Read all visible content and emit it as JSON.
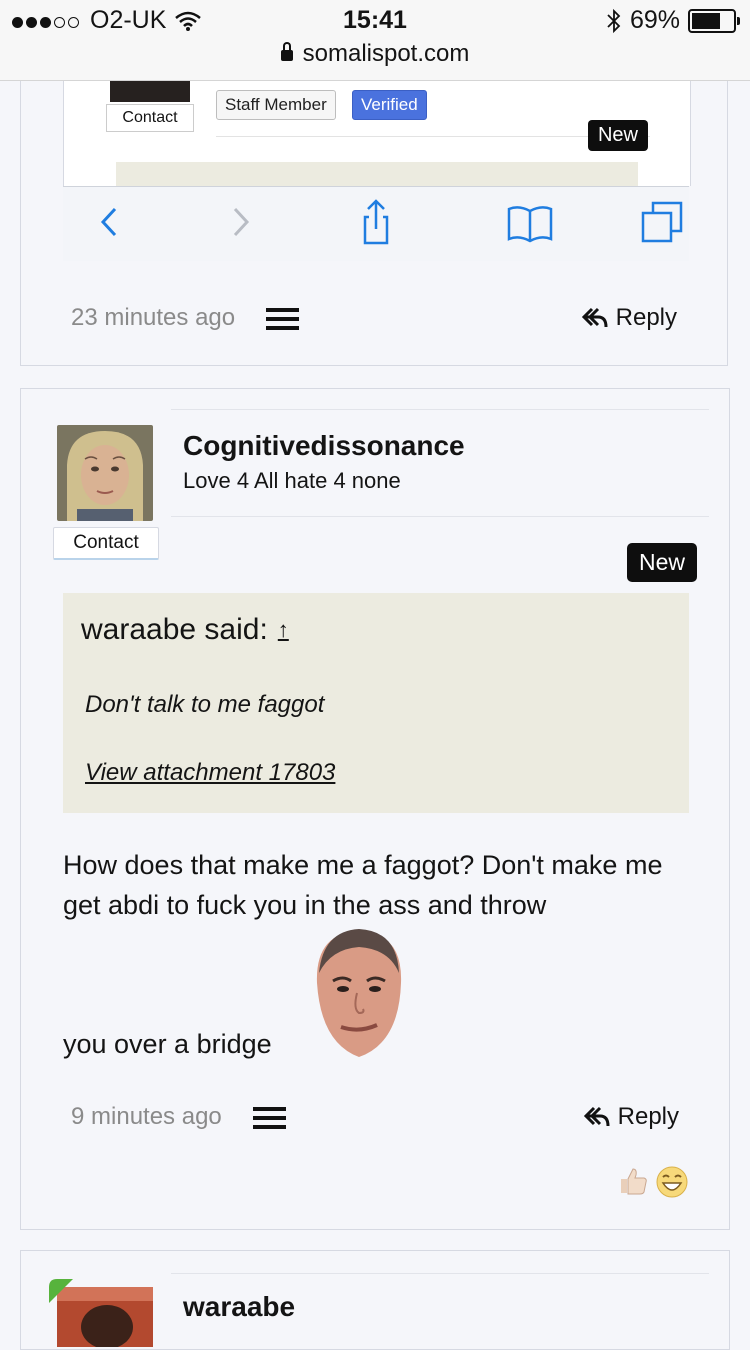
{
  "status_bar": {
    "carrier": "O2-UK",
    "time": "15:41",
    "battery": "69%",
    "battery_level": 0.69,
    "url": "somalispot.com"
  },
  "prev_post": {
    "embedded_screenshot": {
      "contact_label": "Contact",
      "staff_badge": "Staff Member",
      "verified_badge": "Verified",
      "new_label": "New"
    },
    "time": "23 minutes ago",
    "reply_label": "Reply"
  },
  "post": {
    "username": "Cognitivedissonance",
    "user_title": "Love 4 All hate 4 none",
    "contact_label": "Contact",
    "new_label": "New",
    "quote": {
      "author_said": "waraabe said:",
      "text": "Don't talk to me faggot",
      "attachment_link": "View attachment 17803"
    },
    "body": "How does that make me a faggot? Don't make me get abdi to fuck you in the ass and throw",
    "body_end": "you over a bridge",
    "time": "9 minutes ago",
    "reply_label": "Reply",
    "reactions": [
      "thumbs-up-icon",
      "laughing-face-icon"
    ]
  },
  "next_post": {
    "username": "waraabe"
  },
  "colors": {
    "page_bg": "#f5f6fa",
    "quote_bg": "#ecebe0",
    "accent_blue": "#1f7de0",
    "badge_dark": "#0e0e0e",
    "verified_blue": "#4a72de"
  }
}
